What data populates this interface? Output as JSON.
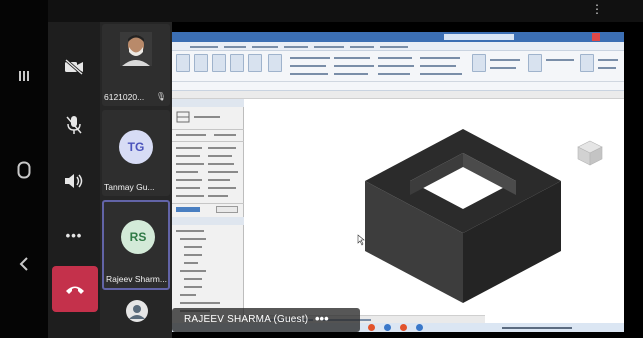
{
  "participants": {
    "p1": {
      "name": "6121020..."
    },
    "p2": {
      "initials": "TG",
      "name": "Tanmay Gu..."
    },
    "p3": {
      "initials": "RS",
      "name": "Rajeev Sharm..."
    }
  },
  "presenter": {
    "label": "RAJEEV SHARMA (Guest)",
    "more": "•••"
  },
  "controls": {
    "more_label": "•••",
    "icons": [
      "camera-off-icon",
      "mic-off-icon",
      "speaker-icon",
      "more-icon",
      "hang-up-icon"
    ]
  },
  "system_nav": {
    "icons": [
      "recents-icon",
      "home-icon",
      "back-icon"
    ]
  },
  "colors": {
    "hangup": "#c4314b",
    "ribbon": "#3c6fb4",
    "tg_avatar": "#d7dcf5",
    "rs_avatar": "#d3ead8"
  }
}
